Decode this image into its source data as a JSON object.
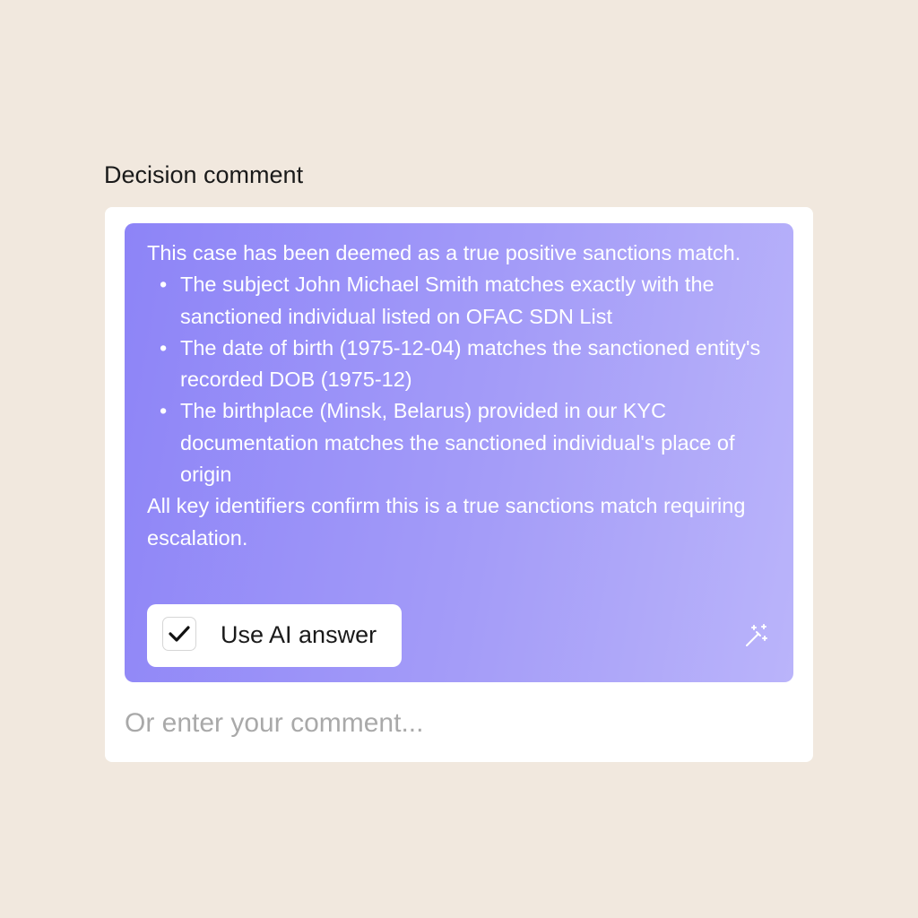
{
  "field": {
    "label": "Decision comment"
  },
  "ai_suggestion": {
    "intro": "This case has been deemed as a true positive sanctions match.",
    "points": [
      "The subject John Michael Smith matches exactly with the sanctioned individual listed on OFAC SDN List",
      "The date of birth (1975-12-04) matches the sanctioned entity's recorded DOB (1975-12)",
      "The birthplace (Minsk, Belarus) provided in our KYC documentation matches the sanctioned individual's place of origin"
    ],
    "conclusion": "All key identifiers confirm this is a true sanctions match requiring escalation.",
    "use_ai_label": "Use AI answer",
    "use_ai_checked": true,
    "icon": "magic-wand-icon"
  },
  "comment": {
    "placeholder": "Or enter your comment...",
    "value": ""
  },
  "colors": {
    "background": "#F1E8DE",
    "panel_gradient_start": "#8D84F7",
    "panel_gradient_end": "#BAB4FA",
    "card": "#FFFFFF"
  }
}
